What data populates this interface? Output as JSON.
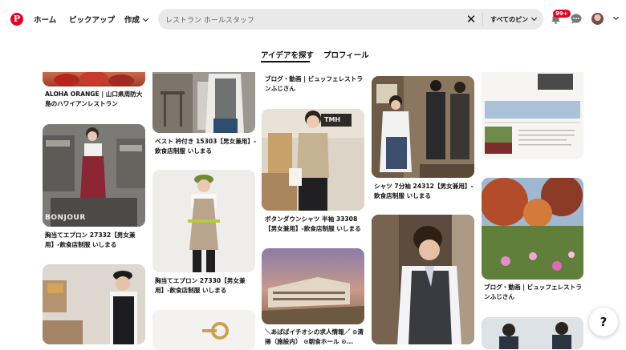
{
  "header": {
    "logo_letter": "P",
    "nav": {
      "home": "ホーム",
      "pickup": "ピックアップ",
      "create": "作成"
    },
    "search": {
      "value": "レストラン ホールスタッフ",
      "filter_label": "すべてのピン"
    },
    "notifications_badge": "99+"
  },
  "tabs": {
    "ideas": "アイデアを探す",
    "profile": "プロフィール"
  },
  "pins": {
    "p1": "ALOHA ORANGE | 山口県周防大島のハワイアンレストラン",
    "p2": "胸当てエプロン 27332【男女兼用】-飲食店制服 いしまる",
    "p2_watermark": "BONJOUR",
    "p4": "ベスト 衿付き 15303【男女兼用】-飲食店制服 いしまる",
    "p5": "胸当てエプロン 27330【男女兼用】-飲食店制服 いしまる",
    "p7": "ブログ・動画 | ビュッフェレストランふじさん",
    "p8": "ボタンダウンシャツ 半袖 33308【男女兼用】-飲食店制服 いしまる",
    "p8_sign": "TMH",
    "p9": "＼あぱぱイチオシの求人情報／ ⊙清掃（施設内） ⊙朝食ホール ⊙...",
    "p10": "シャツ 7分袖 24312【男女兼用】-飲食店制服 いしまる",
    "p13": "ブログ・動画 | ビュッフェレストランふじさん"
  },
  "help_label": "?"
}
